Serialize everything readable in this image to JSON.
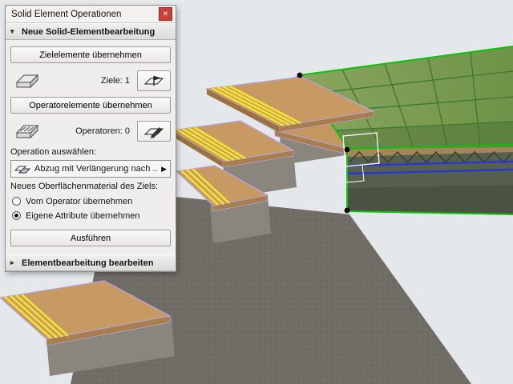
{
  "window": {
    "title": "Solid Element Operationen"
  },
  "icons": {
    "close": "✕",
    "collapse": "▾",
    "expand": "▸",
    "flyout": "▶"
  },
  "panel": {
    "section_new": "Neue Solid-Elementbearbeitung",
    "take_targets": "Zielelemente übernehmen",
    "targets_label": "Ziele:",
    "targets_count": "1",
    "take_operators": "Operatorelemente übernehmen",
    "operators_label": "Operatoren:",
    "operators_count": "0",
    "choose_operation_label": "Operation auswählen:",
    "operation_selected": "Abzug mit Verlängerung nach ...",
    "new_surface_label": "Neues Oberflächenmaterial des Ziels:",
    "radio_from_operator": "Vom Operator übernehmen",
    "radio_own_attributes": "Eigene Attribute übernehmen",
    "selected_radio": "Eigene Attribute übernehmen",
    "execute": "Ausführen",
    "section_edit": "Elementbearbeitung bearbeiten"
  },
  "scene": {
    "description": "3D view of concrete stair with wooden treads and a green-highlighted selected slab",
    "background": "#e4e8ea",
    "concrete": "#77746d",
    "wood": "#c79a63",
    "wood_side": "#a87e4c",
    "selection_outline": "#b5a6e4",
    "stripe_yellow": "#f2e32e",
    "highlight_green": "#0cc20c",
    "grid_green": "#3f7a30",
    "slab_fill": "#7f9c55",
    "line_blue": "#2a35d6"
  }
}
